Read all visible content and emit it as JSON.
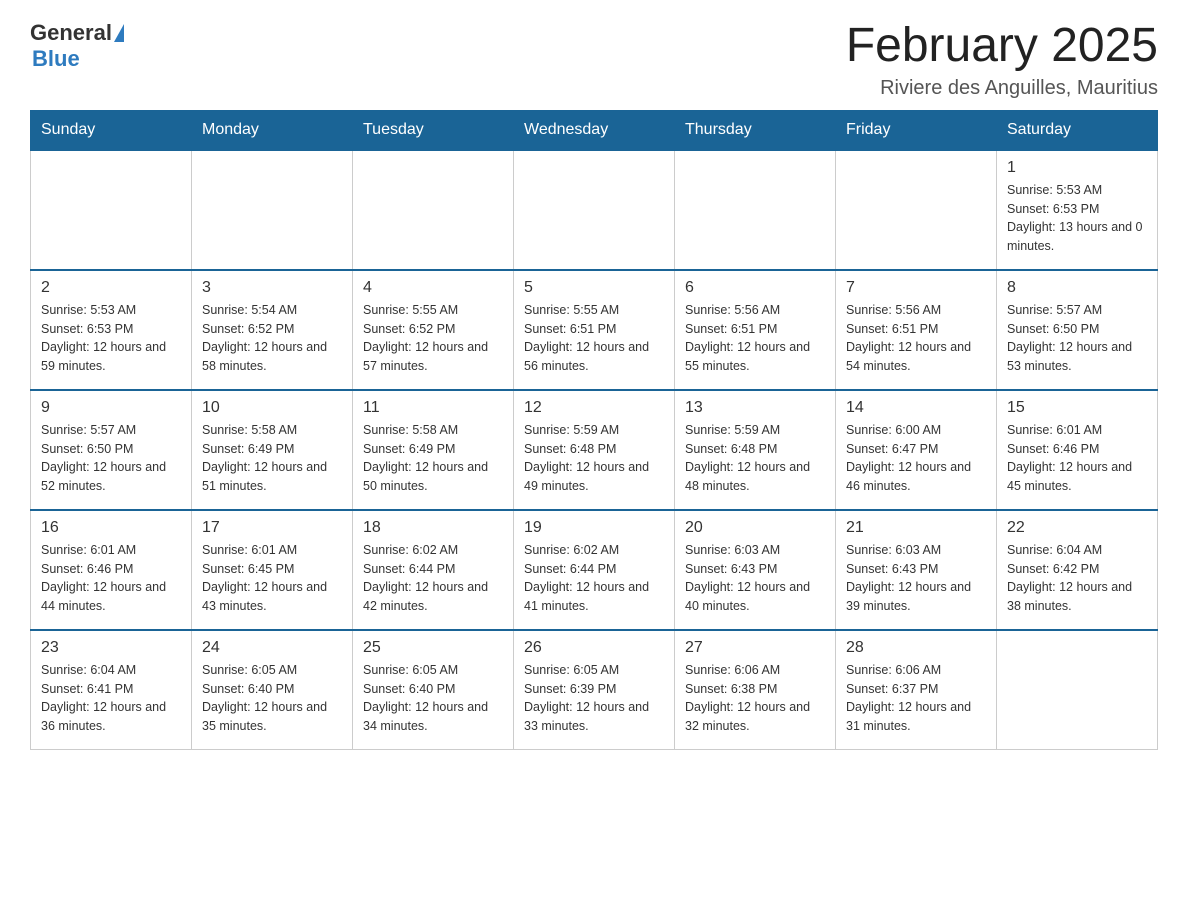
{
  "header": {
    "logo_general": "General",
    "logo_blue": "Blue",
    "title": "February 2025",
    "subtitle": "Riviere des Anguilles, Mauritius"
  },
  "days_of_week": [
    "Sunday",
    "Monday",
    "Tuesday",
    "Wednesday",
    "Thursday",
    "Friday",
    "Saturday"
  ],
  "weeks": [
    [
      {
        "day": "",
        "info": ""
      },
      {
        "day": "",
        "info": ""
      },
      {
        "day": "",
        "info": ""
      },
      {
        "day": "",
        "info": ""
      },
      {
        "day": "",
        "info": ""
      },
      {
        "day": "",
        "info": ""
      },
      {
        "day": "1",
        "info": "Sunrise: 5:53 AM\nSunset: 6:53 PM\nDaylight: 13 hours and 0 minutes."
      }
    ],
    [
      {
        "day": "2",
        "info": "Sunrise: 5:53 AM\nSunset: 6:53 PM\nDaylight: 12 hours and 59 minutes."
      },
      {
        "day": "3",
        "info": "Sunrise: 5:54 AM\nSunset: 6:52 PM\nDaylight: 12 hours and 58 minutes."
      },
      {
        "day": "4",
        "info": "Sunrise: 5:55 AM\nSunset: 6:52 PM\nDaylight: 12 hours and 57 minutes."
      },
      {
        "day": "5",
        "info": "Sunrise: 5:55 AM\nSunset: 6:51 PM\nDaylight: 12 hours and 56 minutes."
      },
      {
        "day": "6",
        "info": "Sunrise: 5:56 AM\nSunset: 6:51 PM\nDaylight: 12 hours and 55 minutes."
      },
      {
        "day": "7",
        "info": "Sunrise: 5:56 AM\nSunset: 6:51 PM\nDaylight: 12 hours and 54 minutes."
      },
      {
        "day": "8",
        "info": "Sunrise: 5:57 AM\nSunset: 6:50 PM\nDaylight: 12 hours and 53 minutes."
      }
    ],
    [
      {
        "day": "9",
        "info": "Sunrise: 5:57 AM\nSunset: 6:50 PM\nDaylight: 12 hours and 52 minutes."
      },
      {
        "day": "10",
        "info": "Sunrise: 5:58 AM\nSunset: 6:49 PM\nDaylight: 12 hours and 51 minutes."
      },
      {
        "day": "11",
        "info": "Sunrise: 5:58 AM\nSunset: 6:49 PM\nDaylight: 12 hours and 50 minutes."
      },
      {
        "day": "12",
        "info": "Sunrise: 5:59 AM\nSunset: 6:48 PM\nDaylight: 12 hours and 49 minutes."
      },
      {
        "day": "13",
        "info": "Sunrise: 5:59 AM\nSunset: 6:48 PM\nDaylight: 12 hours and 48 minutes."
      },
      {
        "day": "14",
        "info": "Sunrise: 6:00 AM\nSunset: 6:47 PM\nDaylight: 12 hours and 46 minutes."
      },
      {
        "day": "15",
        "info": "Sunrise: 6:01 AM\nSunset: 6:46 PM\nDaylight: 12 hours and 45 minutes."
      }
    ],
    [
      {
        "day": "16",
        "info": "Sunrise: 6:01 AM\nSunset: 6:46 PM\nDaylight: 12 hours and 44 minutes."
      },
      {
        "day": "17",
        "info": "Sunrise: 6:01 AM\nSunset: 6:45 PM\nDaylight: 12 hours and 43 minutes."
      },
      {
        "day": "18",
        "info": "Sunrise: 6:02 AM\nSunset: 6:44 PM\nDaylight: 12 hours and 42 minutes."
      },
      {
        "day": "19",
        "info": "Sunrise: 6:02 AM\nSunset: 6:44 PM\nDaylight: 12 hours and 41 minutes."
      },
      {
        "day": "20",
        "info": "Sunrise: 6:03 AM\nSunset: 6:43 PM\nDaylight: 12 hours and 40 minutes."
      },
      {
        "day": "21",
        "info": "Sunrise: 6:03 AM\nSunset: 6:43 PM\nDaylight: 12 hours and 39 minutes."
      },
      {
        "day": "22",
        "info": "Sunrise: 6:04 AM\nSunset: 6:42 PM\nDaylight: 12 hours and 38 minutes."
      }
    ],
    [
      {
        "day": "23",
        "info": "Sunrise: 6:04 AM\nSunset: 6:41 PM\nDaylight: 12 hours and 36 minutes."
      },
      {
        "day": "24",
        "info": "Sunrise: 6:05 AM\nSunset: 6:40 PM\nDaylight: 12 hours and 35 minutes."
      },
      {
        "day": "25",
        "info": "Sunrise: 6:05 AM\nSunset: 6:40 PM\nDaylight: 12 hours and 34 minutes."
      },
      {
        "day": "26",
        "info": "Sunrise: 6:05 AM\nSunset: 6:39 PM\nDaylight: 12 hours and 33 minutes."
      },
      {
        "day": "27",
        "info": "Sunrise: 6:06 AM\nSunset: 6:38 PM\nDaylight: 12 hours and 32 minutes."
      },
      {
        "day": "28",
        "info": "Sunrise: 6:06 AM\nSunset: 6:37 PM\nDaylight: 12 hours and 31 minutes."
      },
      {
        "day": "",
        "info": ""
      }
    ]
  ]
}
